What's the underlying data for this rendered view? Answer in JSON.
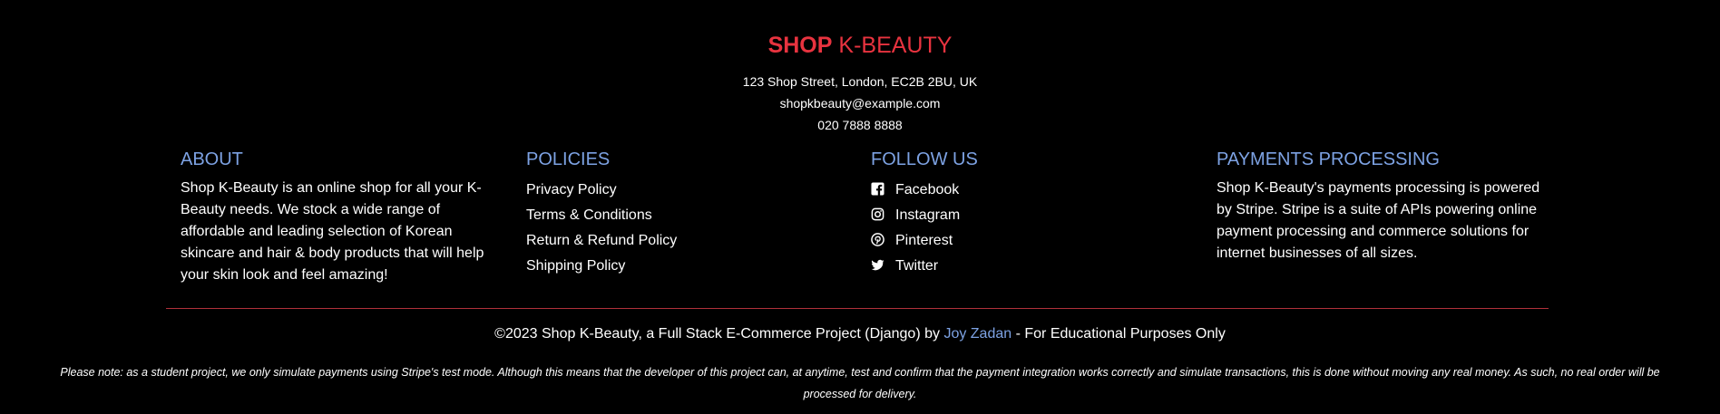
{
  "brand": {
    "shop": "SHOP",
    "kbeauty": "K-BEAUTY"
  },
  "contact": {
    "address": "123 Shop Street, London, EC2B 2BU, UK",
    "email": "shopkbeauty@example.com",
    "phone": "020 7888 8888"
  },
  "about": {
    "heading": "ABOUT",
    "text": "Shop K-Beauty is an online shop for all your K-Beauty needs. We stock a wide range of affordable and leading selection of Korean skincare and hair & body products that will help your skin look and feel amazing!"
  },
  "policies": {
    "heading": "POLICIES",
    "items": [
      "Privacy Policy",
      "Terms & Conditions",
      "Return & Refund Policy",
      "Shipping Policy"
    ]
  },
  "follow": {
    "heading": "FOLLOW US",
    "items": [
      {
        "label": "Facebook",
        "icon": "facebook-icon"
      },
      {
        "label": "Instagram",
        "icon": "instagram-icon"
      },
      {
        "label": "Pinterest",
        "icon": "pinterest-icon"
      },
      {
        "label": "Twitter",
        "icon": "twitter-icon"
      }
    ]
  },
  "payments": {
    "heading": "PAYMENTS PROCESSING",
    "text": "Shop K-Beauty's payments processing is powered by Stripe. Stripe is a suite of APIs powering online payment processing and commerce solutions for internet businesses of all sizes."
  },
  "copyright": {
    "prefix": "©2023 Shop K-Beauty, a Full Stack E-Commerce Project (Django) by ",
    "author": "Joy Zadan",
    "suffix": " - For Educational Purposes Only"
  },
  "note": "Please note: as a student project, we only simulate payments using Stripe's test mode. Although this means that the developer of this project can, at anytime, test and confirm that the payment integration works correctly and simulate transactions, this is done without moving any real money. As such, no real order will be processed for delivery.",
  "colors": {
    "accent_red": "#e8333f",
    "heading_blue": "#7da2e3",
    "divider": "#b0313a",
    "background": "#000000"
  }
}
